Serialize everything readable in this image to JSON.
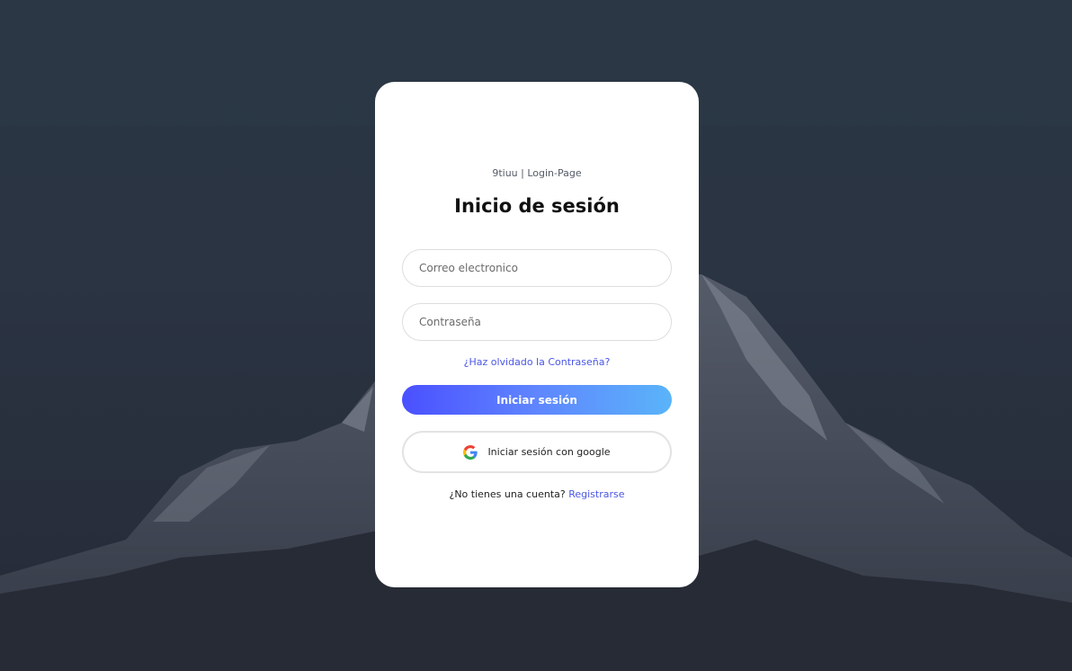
{
  "page": {
    "subtitle": "9tiuu | Login-Page",
    "title": "Inicio de sesión"
  },
  "form": {
    "email_placeholder": "Correo electronico",
    "email_value": "",
    "password_placeholder": "Contraseña",
    "password_value": "",
    "forgot_link": "¿Haz olvidado la Contraseña?",
    "login_button": "Iniciar sesión",
    "google_button": "Iniciar sesión con google",
    "google_icon": "google-icon"
  },
  "signup": {
    "prompt": "¿No tienes una cuenta?",
    "link": "Registrarse"
  },
  "colors": {
    "link": "#4a56e6",
    "button_gradient_start": "#4a50ff",
    "button_gradient_end": "#5ab4f9",
    "background": "#2a3442"
  }
}
